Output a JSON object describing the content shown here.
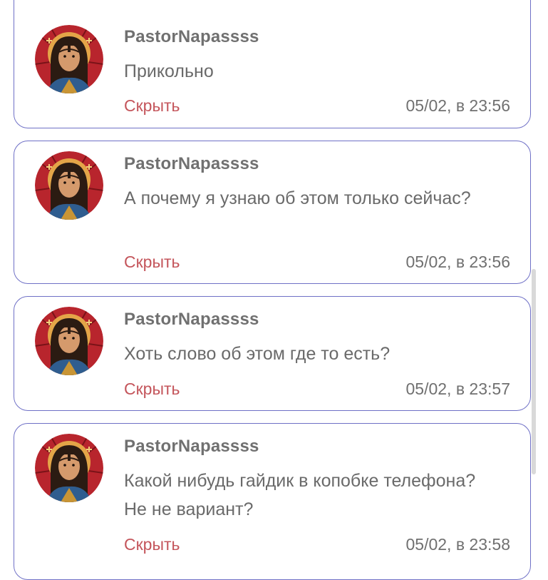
{
  "comments": [
    {
      "author": "PastorNapassss",
      "text": "Прикольно",
      "hide_label": "Скрыть",
      "time": "05/02, в 23:56"
    },
    {
      "author": "PastorNapassss",
      "text": "А почему я узнаю об этом только сейчас?",
      "hide_label": "Скрыть",
      "time": "05/02, в 23:56"
    },
    {
      "author": "PastorNapassss",
      "text": "Хоть слово об этом где то есть?",
      "hide_label": "Скрыть",
      "time": "05/02, в 23:57"
    },
    {
      "author": "PastorNapassss",
      "text": "Какой нибудь гайдик в копобке телефона? Не не вариант?",
      "hide_label": "Скрыть",
      "time": "05/02, в 23:58"
    }
  ],
  "avatar_icon": "jesus-portrait-icon",
  "colors": {
    "border": "#6f70c6",
    "hide_link": "#c4555b",
    "text": "#6a6a6a",
    "avatar_bg": "#b8252d"
  }
}
